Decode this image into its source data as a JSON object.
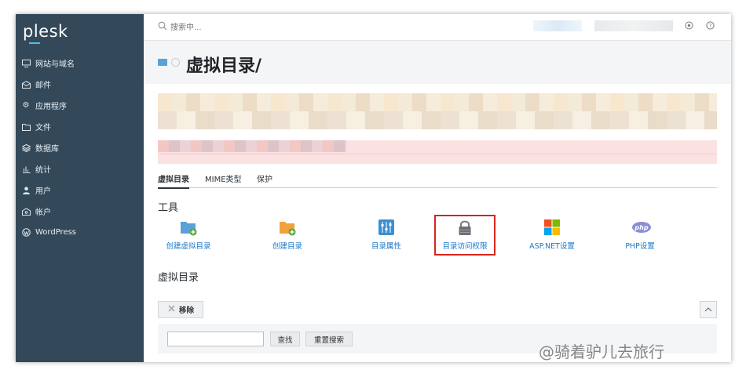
{
  "sidebar": {
    "logo": "plesk",
    "items": [
      {
        "label": "网站与域名",
        "icon": "monitor-icon"
      },
      {
        "label": "邮件",
        "icon": "mail-icon"
      },
      {
        "label": "应用程序",
        "icon": "gear-icon"
      },
      {
        "label": "文件",
        "icon": "folder-icon"
      },
      {
        "label": "数据库",
        "icon": "database-icon"
      },
      {
        "label": "统计",
        "icon": "bar-chart-icon"
      },
      {
        "label": "用户",
        "icon": "user-icon"
      },
      {
        "label": "帐户",
        "icon": "account-icon"
      },
      {
        "label": "WordPress",
        "icon": "wordpress-icon"
      }
    ],
    "collapse_label": "‹"
  },
  "topbar": {
    "search_placeholder": "搜索中..."
  },
  "header": {
    "title": "虚拟目录/"
  },
  "tabs": [
    {
      "label": "虚拟目录",
      "active": true
    },
    {
      "label": "MIME类型",
      "active": false
    },
    {
      "label": "保护",
      "active": false
    }
  ],
  "tools_title": "工具",
  "tools": [
    {
      "label": "创建虚拟目录",
      "icon": "add-virtual-folder-icon"
    },
    {
      "label": "创建目录",
      "icon": "add-folder-icon"
    },
    {
      "label": "目录属性",
      "icon": "properties-icon"
    },
    {
      "label": "目录访问权限",
      "icon": "lock-icon"
    },
    {
      "label": "ASP.NET设置",
      "icon": "windows-icon"
    },
    {
      "label": "PHP设置",
      "icon": "php-icon"
    }
  ],
  "list_title": "虚拟目录",
  "list": {
    "remove_label": "移除",
    "search_button": "查找",
    "reset_button": "重置搜索"
  },
  "watermark": "@骑着驴儿去旅行",
  "colors": {
    "sidebar_bg": "#33495a",
    "link": "#1b77c9",
    "highlight": "#d9231e"
  }
}
